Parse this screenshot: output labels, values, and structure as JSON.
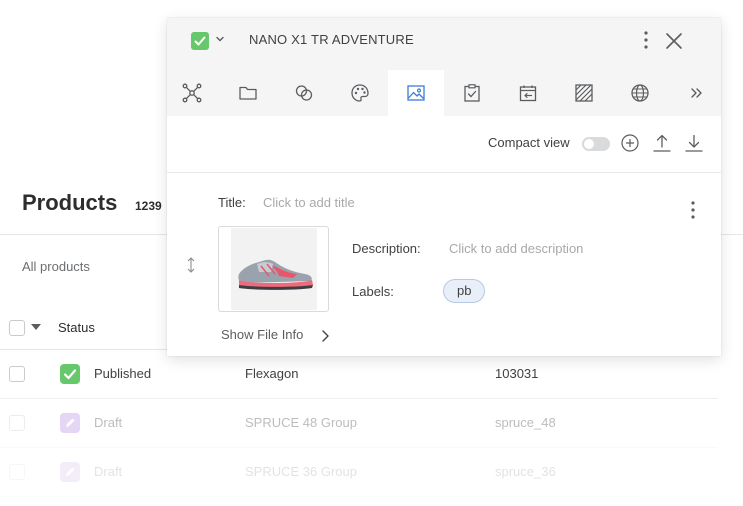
{
  "products_page": {
    "title": "Products",
    "count": "1239",
    "filter_label": "All products",
    "column_status": "Status",
    "rows": [
      {
        "status": "Published",
        "name": "Flexagon",
        "code": "103031",
        "status_color": "#67c76b"
      },
      {
        "status": "Draft",
        "name": "SPRUCE 48 Group",
        "code": "spruce_48",
        "status_color": "#b38be0"
      },
      {
        "status": "Draft",
        "name": "SPRUCE 36 Group",
        "code": "spruce_36",
        "status_color": "#b38be0"
      }
    ]
  },
  "panel": {
    "title": "NANO X1 TR ADVENTURE",
    "tabs": [
      {
        "icon": "structure-icon"
      },
      {
        "icon": "folder-icon"
      },
      {
        "icon": "links-icon"
      },
      {
        "icon": "palette-icon"
      },
      {
        "icon": "image-icon",
        "active": true
      },
      {
        "icon": "clipboard-check-icon"
      },
      {
        "icon": "calendar-back-icon"
      },
      {
        "icon": "hatched-square-icon"
      },
      {
        "icon": "globe-icon"
      },
      {
        "icon": "double-chevron-right-icon"
      }
    ],
    "toolbar": {
      "compact_view_label": "Compact view",
      "compact_view_on": false
    },
    "asset": {
      "title_label": "Title:",
      "title_placeholder": "Click to add title",
      "description_label": "Description:",
      "description_placeholder": "Click to add description",
      "labels_label": "Labels:",
      "labels": [
        "pb"
      ],
      "file_info_label": "Show File Info"
    }
  },
  "colors": {
    "accent_green": "#67c76b",
    "draft_purple": "#b38be0",
    "chip_bg": "#e8eff9"
  }
}
